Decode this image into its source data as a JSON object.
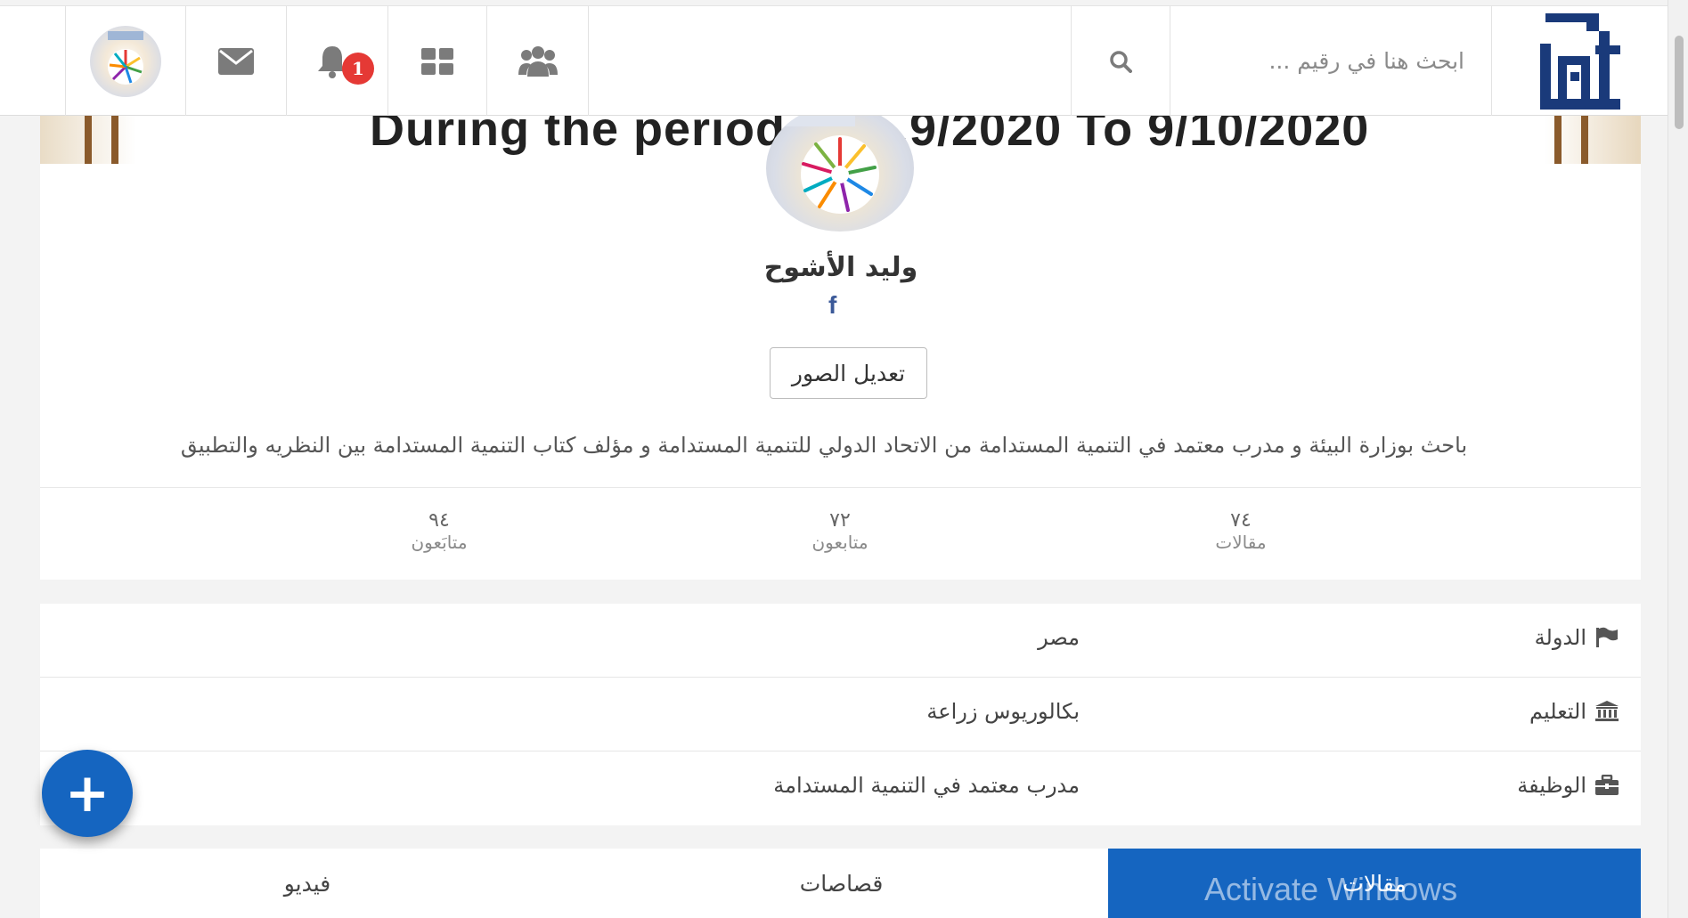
{
  "header": {
    "logo_alt": "Raqeem",
    "search_placeholder": "ابحث هنا في رقيم ...",
    "notification_count": "1",
    "icons": [
      "search-icon",
      "users-icon",
      "apps-grid-icon",
      "bell-icon",
      "envelope-icon",
      "avatar"
    ]
  },
  "cover": {
    "text": "During the period fro...9/2020  To 9/10/2020"
  },
  "profile": {
    "name": "وليد الأشوح",
    "social_icon": "f",
    "edit_button": "تعديل الصور",
    "bio": "باحث بوزارة البيئة و مدرب معتمد في التنمية المستدامة من الاتحاد الدولي للتنمية المستدامة و مؤلف كتاب التنمية المستدامة بين النظريه والتطبيق",
    "stats": [
      {
        "value": "٧٤",
        "label": "مقالات"
      },
      {
        "value": "٧٢",
        "label": "متابعون"
      },
      {
        "value": "٩٤",
        "label": "متابَعون"
      }
    ]
  },
  "info": [
    {
      "label": "الدولة",
      "value": "مصر",
      "icon": "flag-icon"
    },
    {
      "label": "التعليم",
      "value": "بكالوريوس زراعة",
      "icon": "institution-icon"
    },
    {
      "label": "الوظيفة",
      "value": "مدرب معتمد في التنمية المستدامة",
      "icon": "briefcase-icon"
    }
  ],
  "tabs": [
    {
      "label": "مقالات",
      "active": true
    },
    {
      "label": "قصاصات",
      "active": false
    },
    {
      "label": "فيديو",
      "active": false
    }
  ],
  "fab": {
    "label": "+"
  },
  "watermark": "Activate Windows",
  "colors": {
    "accent": "#1565c0",
    "badge": "#e53935",
    "logo": "#1a3a7a"
  }
}
